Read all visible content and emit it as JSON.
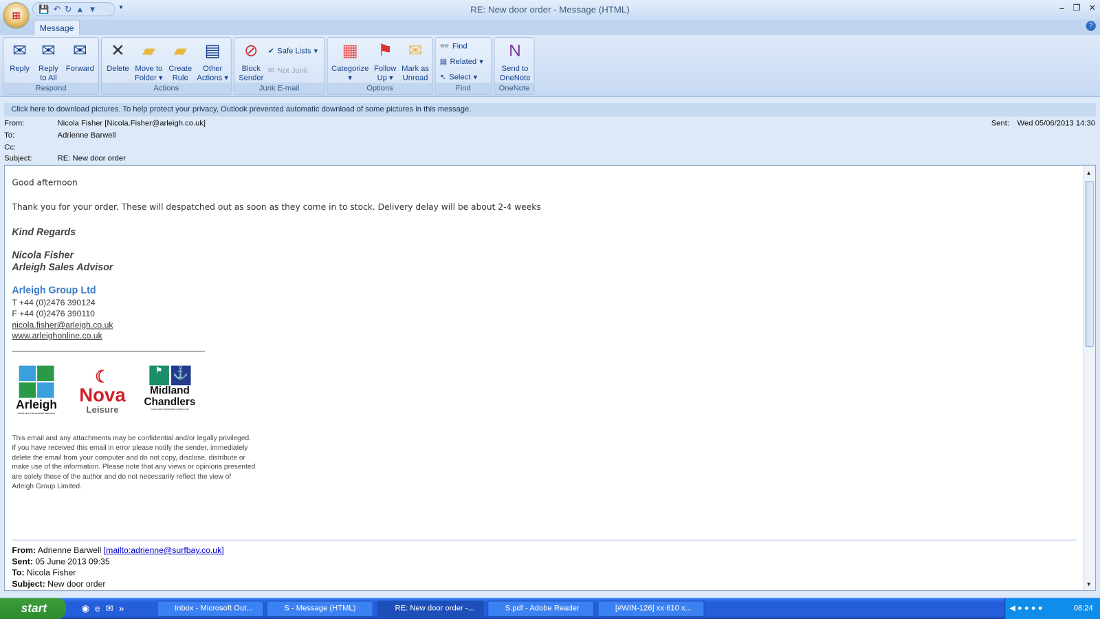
{
  "window": {
    "title": "RE: New door order - Message (HTML)",
    "tab": "Message"
  },
  "ribbon": {
    "respond": {
      "label": "Respond",
      "reply": "Reply",
      "reply_all": "Reply to All",
      "forward": "Forward"
    },
    "actions": {
      "label": "Actions",
      "delete": "Delete",
      "move": "Move to Folder",
      "create_rule": "Create Rule",
      "other": "Other Actions"
    },
    "junk": {
      "label": "Junk E-mail",
      "block": "Block Sender",
      "safe_lists": "Safe Lists",
      "not_junk": "Not Junk"
    },
    "options": {
      "label": "Options",
      "categorize": "Categorize",
      "follow_up": "Follow Up",
      "mark_unread": "Mark as Unread"
    },
    "find": {
      "label": "Find",
      "find": "Find",
      "related": "Related",
      "select": "Select"
    },
    "onenote": {
      "label": "OneNote",
      "send": "Send to OneNote"
    }
  },
  "infobar": "Click here to download pictures. To help protect your privacy, Outlook prevented automatic download of some pictures in this message.",
  "header": {
    "from_label": "From:",
    "from": "Nicola Fisher [Nicola.Fisher@arleigh.co.uk]",
    "to_label": "To:",
    "to": "Adrienne Barwell",
    "cc_label": "Cc:",
    "subject_label": "Subject:",
    "subject": "RE: New door order",
    "sent_label": "Sent:",
    "sent": "Wed 05/06/2013 14:30"
  },
  "message": {
    "greeting": "Good afternoon",
    "line1": "Thank you for your order.  These will despatched out as soon as they come in to stock.  Delivery delay will be about 2-4 weeks",
    "regards": "Kind Regards",
    "name": "Nicola Fisher",
    "role": "Arleigh Sales Advisor",
    "company": "Arleigh Group Ltd",
    "phone": "T +44 (0)2476 390124",
    "fax": "F +44 (0)2476 390110",
    "email": "nicola.fisher@arleigh.co.uk",
    "web": "www.arleighonline.co.uk",
    "logos": {
      "arleigh": "Arleigh",
      "arleigh_tag": "SUPPLYING THE LEISURE INDUSTRY",
      "nova": "Nova",
      "nova_sub": "Leisure",
      "midland": "Midland",
      "chandlers": "Chandlers",
      "midland_tag": "CANALBOAT EQUIPMENT SINCE 1979"
    },
    "disclaimer": [
      "This email and any attachments may be confidential and/or legally privileged.",
      "If you have received this email in error please notify the sender, immediately",
      "delete the email from your computer and do not copy, disclose, distribute or",
      "make use of the information. Please note that any views or opinions presented",
      "are solely those of the author and do not necessarily reflect the view of",
      "Arleigh Group Limited."
    ],
    "quoted": {
      "from_label": "From:",
      "from": "Adrienne Barwell",
      "from_link": "[mailto:adrienne@surfbay.co.uk]",
      "sent_label": "Sent:",
      "sent": "05 June 2013 09:35",
      "to_label": "To:",
      "to": "Nicola Fisher",
      "subject_label": "Subject:",
      "subject": "New door order"
    }
  },
  "taskbar": {
    "start": "start",
    "tasks": [
      "Inbox - Microsoft Out...",
      "S - Message (HTML)",
      "RE: New door order -...",
      "S.pdf - Adobe Reader",
      "[#WIN-126] xx 610 x..."
    ],
    "clock": "08:24"
  }
}
